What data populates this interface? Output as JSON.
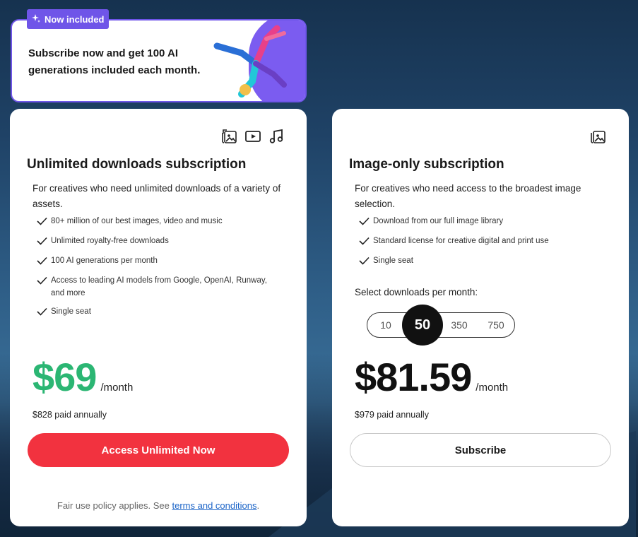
{
  "promo": {
    "badge": "Now included",
    "text": "Subscribe now and get 100 AI generations included each month."
  },
  "unlimited": {
    "title": "Unlimited downloads subscription",
    "description": "For creatives who need unlimited downloads of a variety of assets.",
    "asset_icons": [
      "image-icon",
      "video-icon",
      "music-icon"
    ],
    "features": [
      "80+ million of our best images, video and music",
      "Unlimited royalty-free downloads",
      "100 AI generations per month",
      "Access to leading AI models from Google, OpenAI, Runway, and more",
      "Single seat"
    ],
    "price": "$69",
    "period": "/month",
    "annual": "$828 paid annually",
    "cta": "Access Unlimited Now",
    "fair_use_prefix": "Fair use policy applies. See ",
    "fair_use_link": "terms and conditions",
    "fair_use_suffix": "."
  },
  "image_only": {
    "title": "Image-only subscription",
    "description": "For creatives who need access to the broadest image selection.",
    "asset_icons": [
      "image-icon"
    ],
    "features": [
      "Download from our full image library",
      "Standard license for creative digital and print use",
      "Single seat"
    ],
    "select_label": "Select downloads per month:",
    "options": [
      "10",
      "50",
      "350",
      "750"
    ],
    "selected": "50",
    "price": "$81.59",
    "period": "/month",
    "annual": "$979 paid annually",
    "cta": "Subscribe"
  },
  "colors": {
    "accent_purple": "#6f55e8",
    "price_green": "#2bb673",
    "cta_red": "#f2323f"
  }
}
